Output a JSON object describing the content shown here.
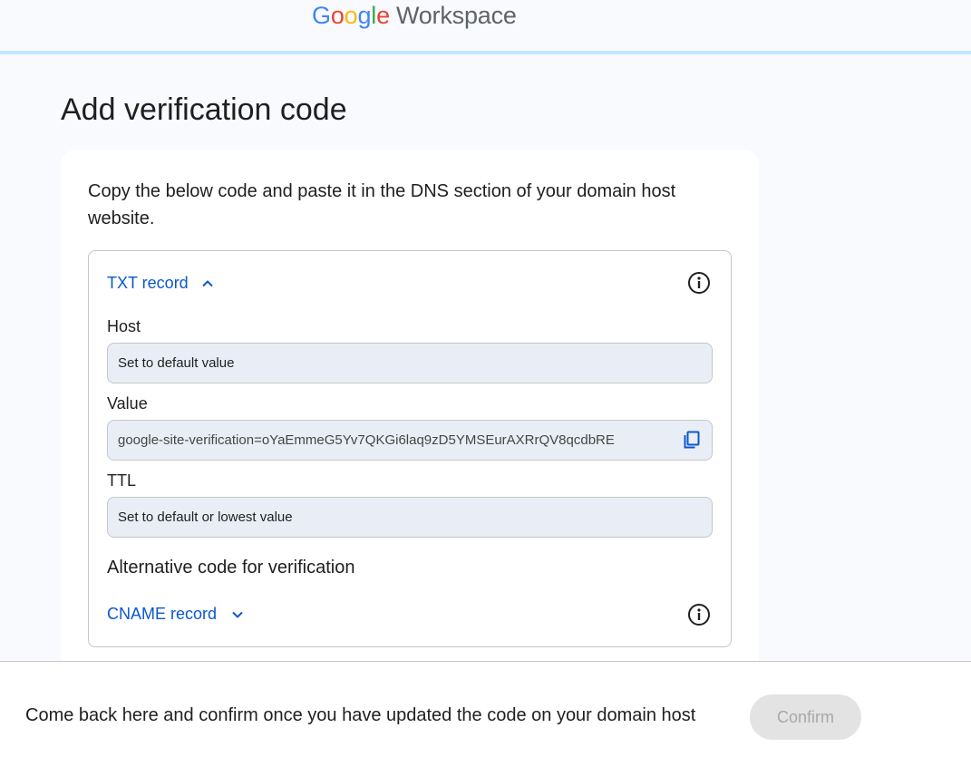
{
  "header": {
    "logo_google": "Google",
    "logo_product": "Workspace"
  },
  "page": {
    "title": "Add verification code",
    "instruction": "Copy the below code and paste it in the DNS section of your domain host website."
  },
  "txt_record": {
    "toggle_label": "TXT record",
    "expanded": true,
    "fields": {
      "host_label": "Host",
      "host_value": "Set to default value",
      "value_label": "Value",
      "value_value": "google-site-verification=oYaEmmeG5Yv7QKGi6laq9zD5YMSEurAXRrQV8qcdbRE",
      "ttl_label": "TTL",
      "ttl_value": "Set to default or lowest value"
    }
  },
  "alternative": {
    "heading": "Alternative code for verification",
    "toggle_label": "CNAME record",
    "expanded": false
  },
  "icons": {
    "info": "info-icon",
    "copy": "copy-icon",
    "chevron_up": "chevron-up-icon",
    "chevron_down": "chevron-down-icon"
  },
  "footer": {
    "text": "Come back here and confirm once you have updated the code on your domain host",
    "confirm_label": "Confirm",
    "confirm_enabled": false
  },
  "colors": {
    "accent": "#0b57d0",
    "progress": "#c2e7ff",
    "field_bg": "#e9eef6",
    "page_bg": "#f8fafd"
  }
}
